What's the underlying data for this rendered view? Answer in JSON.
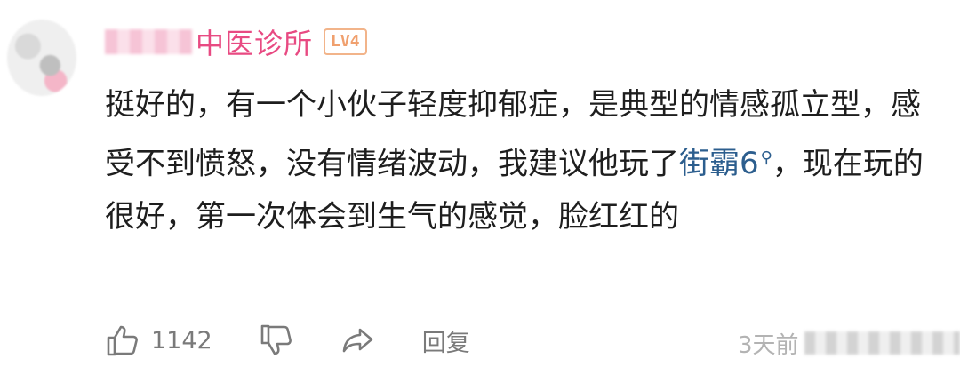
{
  "comment": {
    "username": "中医诊所",
    "level_badge": "LV4",
    "text_part1": "挺好的，有一个小伙子轻度抑郁症，是典型的情感孤立型，感受不到愤怒，没有情绪波动，我建议他玩了",
    "link_text": "街霸6",
    "text_part2": "，现在玩的很好，第一次体会到生气的感觉，脸红红的",
    "like_count": "1142",
    "reply_label": "回复",
    "timestamp": "3天前"
  },
  "icons": {
    "like": "thumbs-up-icon",
    "dislike": "thumbs-down-icon",
    "share": "share-icon",
    "search": "search-icon"
  },
  "colors": {
    "username": "#e84a82",
    "link": "#2c5e8e",
    "level_badge": "#f0a06e"
  }
}
